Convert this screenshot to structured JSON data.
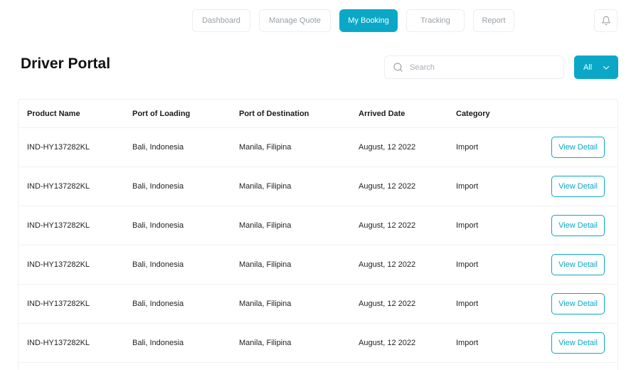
{
  "nav": {
    "tabs": [
      {
        "label": "Dashboard",
        "width": 82
      },
      {
        "label": "Manage Quote",
        "width": 101
      },
      {
        "label": "My Booking",
        "width": 82,
        "active": true
      },
      {
        "label": "Tracking",
        "width": 82
      },
      {
        "label": "Report",
        "width": 58
      }
    ]
  },
  "header": {
    "title": "Driver Portal",
    "search_placeholder": "Search",
    "filter_label": "All"
  },
  "table": {
    "columns": [
      "Product Name",
      "Port of Loading",
      "Port of Destination",
      "Arrived Date",
      "Category"
    ],
    "rows": [
      {
        "product": "IND-HY137282KL",
        "loading": "Bali, Indonesia",
        "destination": "Manila, Filipina",
        "date": "August, 12 2022",
        "category": "Import",
        "action": "View Detail"
      },
      {
        "product": "IND-HY137282KL",
        "loading": "Bali, Indonesia",
        "destination": "Manila, Filipina",
        "date": "August, 12 2022",
        "category": "Import",
        "action": "View Detail"
      },
      {
        "product": "IND-HY137282KL",
        "loading": "Bali, Indonesia",
        "destination": "Manila, Filipina",
        "date": "August, 12 2022",
        "category": "Import",
        "action": "View Detail"
      },
      {
        "product": "IND-HY137282KL",
        "loading": "Bali, Indonesia",
        "destination": "Manila, Filipina",
        "date": "August, 12 2022",
        "category": "Import",
        "action": "View Detail"
      },
      {
        "product": "IND-HY137282KL",
        "loading": "Bali, Indonesia",
        "destination": "Manila, Filipina",
        "date": "August, 12 2022",
        "category": "Import",
        "action": "View Detail"
      },
      {
        "product": "IND-HY137282KL",
        "loading": "Bali, Indonesia",
        "destination": "Manila, Filipina",
        "date": "August, 12 2022",
        "category": "Import",
        "action": "View Detail"
      }
    ]
  },
  "colors": {
    "accent": "#0aa8c6",
    "border": "#eceef0"
  },
  "icons": {
    "bell": "bell-icon",
    "search": "search-icon",
    "dropdown": "chevron-down-icon"
  }
}
